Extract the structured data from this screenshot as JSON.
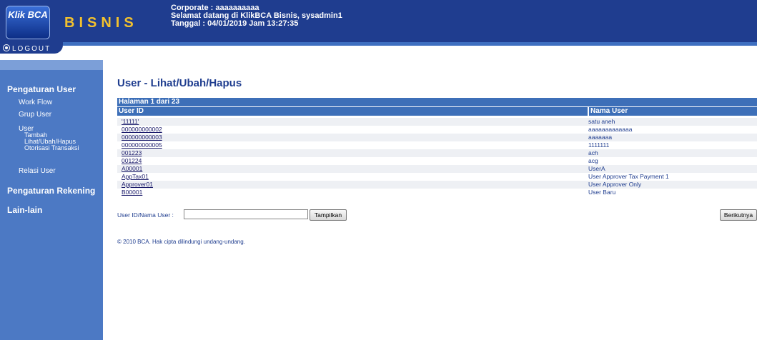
{
  "header": {
    "logo": "Klik BCA",
    "brand": "BISNIS",
    "corporate": "Corporate : aaaaaaaaaa",
    "welcome": "Selamat datang di KlikBCA Bisnis, sysadmin1",
    "date": "Tanggal : 04/01/2019 Jam 13:27:35",
    "logout": "LOGOUT"
  },
  "sidebar": {
    "section1": "Pengaturan User",
    "workflow": "Work Flow",
    "grup": "Grup User",
    "user": "User",
    "user_sub": [
      "Tambah",
      "Lihat/Ubah/Hapus",
      "Otorisasi Transaksi"
    ],
    "relasi": "Relasi User",
    "section2": "Pengaturan Rekening",
    "section3": "Lain-lain"
  },
  "main": {
    "title": "User - Lihat/Ubah/Hapus",
    "pager": "Halaman 1 dari 23",
    "columns": [
      "User ID",
      "Nama User"
    ],
    "rows": [
      {
        "id": "'11111'",
        "name": "satu aneh"
      },
      {
        "id": "000000000002",
        "name": "aaaaaaaaaaaaa"
      },
      {
        "id": "000000000003",
        "name": "aaaaaaa"
      },
      {
        "id": "000000000005",
        "name": "1111111"
      },
      {
        "id": "001223",
        "name": "ach"
      },
      {
        "id": "001224",
        "name": "acg"
      },
      {
        "id": "A00001",
        "name": "UserA"
      },
      {
        "id": "AppTax01",
        "name": "User Approver Tax Payment 1"
      },
      {
        "id": "Approver01",
        "name": "User Approver Only"
      },
      {
        "id": "B00001",
        "name": "User Baru"
      }
    ],
    "search_label": "User ID/Nama User :",
    "search_value": "",
    "show_button": "Tampilkan",
    "next_button": "Berikutnya",
    "footer": "©  2010 BCA. Hak cipta dilindungi undang-undang."
  }
}
